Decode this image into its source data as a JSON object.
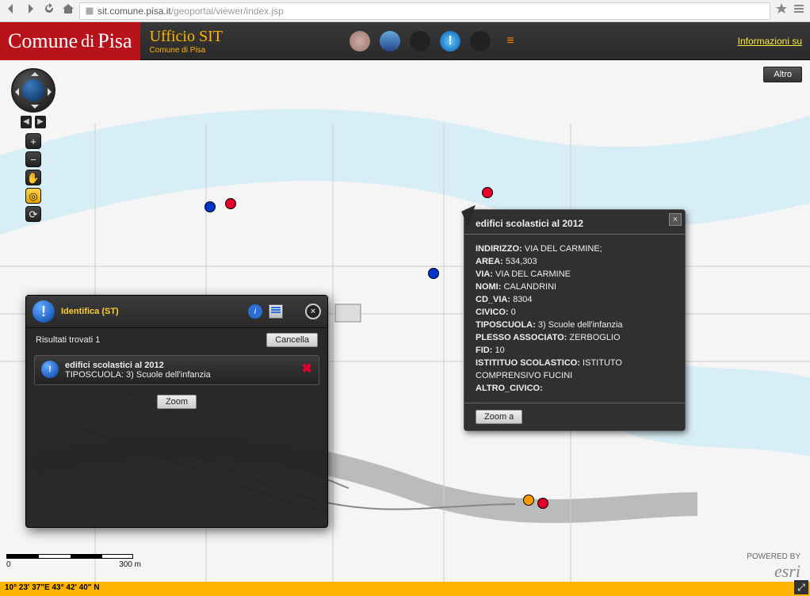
{
  "browser": {
    "host": "sit.comune.pisa.it",
    "path": "/geoportal/viewer/index.jsp"
  },
  "header": {
    "brand_a": "Comune",
    "brand_b": "di",
    "brand_c": "Pisa",
    "sub_a": "Ufficio SIT",
    "sub_b": "Comune di Pisa",
    "info": "Informazioni su"
  },
  "altro": "Altro",
  "scale": {
    "a": "0",
    "b": "300 m"
  },
  "coords": "10° 23' 37\"E 43° 42' 40\" N",
  "esri": {
    "small": "POWERED BY",
    "big": "esri"
  },
  "identify": {
    "title": "Identifica (ST)",
    "found": "Risultati trovati 1",
    "cancel": "Cancella",
    "row_title": "edifici scolastici al 2012",
    "row_sub": "TIPOSCUOLA: 3) Scuole dell'infanzia",
    "zoom": "Zoom"
  },
  "popup": {
    "title": "edifici scolastici al 2012",
    "fields": {
      "INDIRIZZO": "VIA DEL CARMINE;",
      "AREA": "534,303",
      "VIA": "VIA DEL CARMINE",
      "NOMI": "CALANDRINI",
      "CD_VIA": "8304",
      "CIVICO": "0",
      "TIPOSCUOLA": "3)  Scuole dell'infanzia",
      "PLESSO ASSOCIATO": "ZERBOGLIO",
      "FID": "10",
      "ISTITITUO SCOLASTICO": "ISTITUTO COMPRENSIVO FUCINI",
      "ALTRO_CIVICO": ""
    },
    "zoom": "Zoom a"
  }
}
